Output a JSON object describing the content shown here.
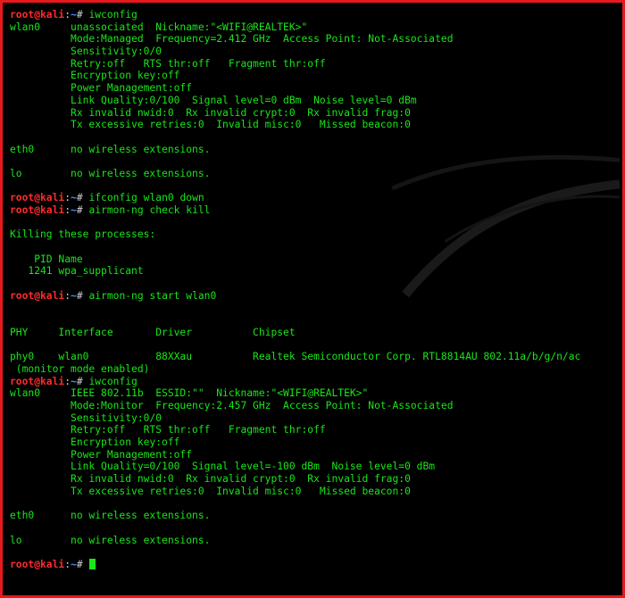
{
  "prompt": {
    "user": "root@kali",
    "sep": ":",
    "path": "~",
    "symbol": "# "
  },
  "lines": [
    {
      "type": "prompt",
      "cmd": "iwconfig"
    },
    {
      "type": "text",
      "text": "wlan0     unassociated  Nickname:\"<WIFI@REALTEK>\""
    },
    {
      "type": "text",
      "text": "          Mode:Managed  Frequency=2.412 GHz  Access Point: Not-Associated"
    },
    {
      "type": "text",
      "text": "          Sensitivity:0/0"
    },
    {
      "type": "text",
      "text": "          Retry:off   RTS thr:off   Fragment thr:off"
    },
    {
      "type": "text",
      "text": "          Encryption key:off"
    },
    {
      "type": "text",
      "text": "          Power Management:off"
    },
    {
      "type": "text",
      "text": "          Link Quality:0/100  Signal level=0 dBm  Noise level=0 dBm"
    },
    {
      "type": "text",
      "text": "          Rx invalid nwid:0  Rx invalid crypt:0  Rx invalid frag:0"
    },
    {
      "type": "text",
      "text": "          Tx excessive retries:0  Invalid misc:0   Missed beacon:0"
    },
    {
      "type": "text",
      "text": ""
    },
    {
      "type": "text",
      "text": "eth0      no wireless extensions."
    },
    {
      "type": "text",
      "text": ""
    },
    {
      "type": "text",
      "text": "lo        no wireless extensions."
    },
    {
      "type": "text",
      "text": ""
    },
    {
      "type": "prompt",
      "cmd": "ifconfig wlan0 down"
    },
    {
      "type": "prompt",
      "cmd": "airmon-ng check kill"
    },
    {
      "type": "text",
      "text": ""
    },
    {
      "type": "text",
      "text": "Killing these processes:"
    },
    {
      "type": "text",
      "text": ""
    },
    {
      "type": "text",
      "text": "    PID Name"
    },
    {
      "type": "text",
      "text": "   1241 wpa_supplicant"
    },
    {
      "type": "text",
      "text": ""
    },
    {
      "type": "prompt",
      "cmd": "airmon-ng start wlan0"
    },
    {
      "type": "text",
      "text": ""
    },
    {
      "type": "text",
      "text": ""
    },
    {
      "type": "text",
      "text": "PHY     Interface       Driver          Chipset"
    },
    {
      "type": "text",
      "text": ""
    },
    {
      "type": "text",
      "text": "phy0    wlan0           88XXau          Realtek Semiconductor Corp. RTL8814AU 802.11a/b/g/n/ac"
    },
    {
      "type": "text",
      "text": " (monitor mode enabled)"
    },
    {
      "type": "prompt",
      "cmd": "iwconfig"
    },
    {
      "type": "text",
      "text": "wlan0     IEEE 802.11b  ESSID:\"\"  Nickname:\"<WIFI@REALTEK>\""
    },
    {
      "type": "text",
      "text": "          Mode:Monitor  Frequency:2.457 GHz  Access Point: Not-Associated"
    },
    {
      "type": "text",
      "text": "          Sensitivity:0/0"
    },
    {
      "type": "text",
      "text": "          Retry:off   RTS thr:off   Fragment thr:off"
    },
    {
      "type": "text",
      "text": "          Encryption key:off"
    },
    {
      "type": "text",
      "text": "          Power Management:off"
    },
    {
      "type": "text",
      "text": "          Link Quality=0/100  Signal level=-100 dBm  Noise level=0 dBm"
    },
    {
      "type": "text",
      "text": "          Rx invalid nwid:0  Rx invalid crypt:0  Rx invalid frag:0"
    },
    {
      "type": "text",
      "text": "          Tx excessive retries:0  Invalid misc:0   Missed beacon:0"
    },
    {
      "type": "text",
      "text": ""
    },
    {
      "type": "text",
      "text": "eth0      no wireless extensions."
    },
    {
      "type": "text",
      "text": ""
    },
    {
      "type": "text",
      "text": "lo        no wireless extensions."
    },
    {
      "type": "text",
      "text": ""
    },
    {
      "type": "prompt",
      "cmd": "",
      "cursor": true
    }
  ],
  "colors": {
    "frame": "#e8191d",
    "background": "#000000",
    "text": "#19e619",
    "user": "#ff2b2b",
    "path": "#3f8cff"
  }
}
